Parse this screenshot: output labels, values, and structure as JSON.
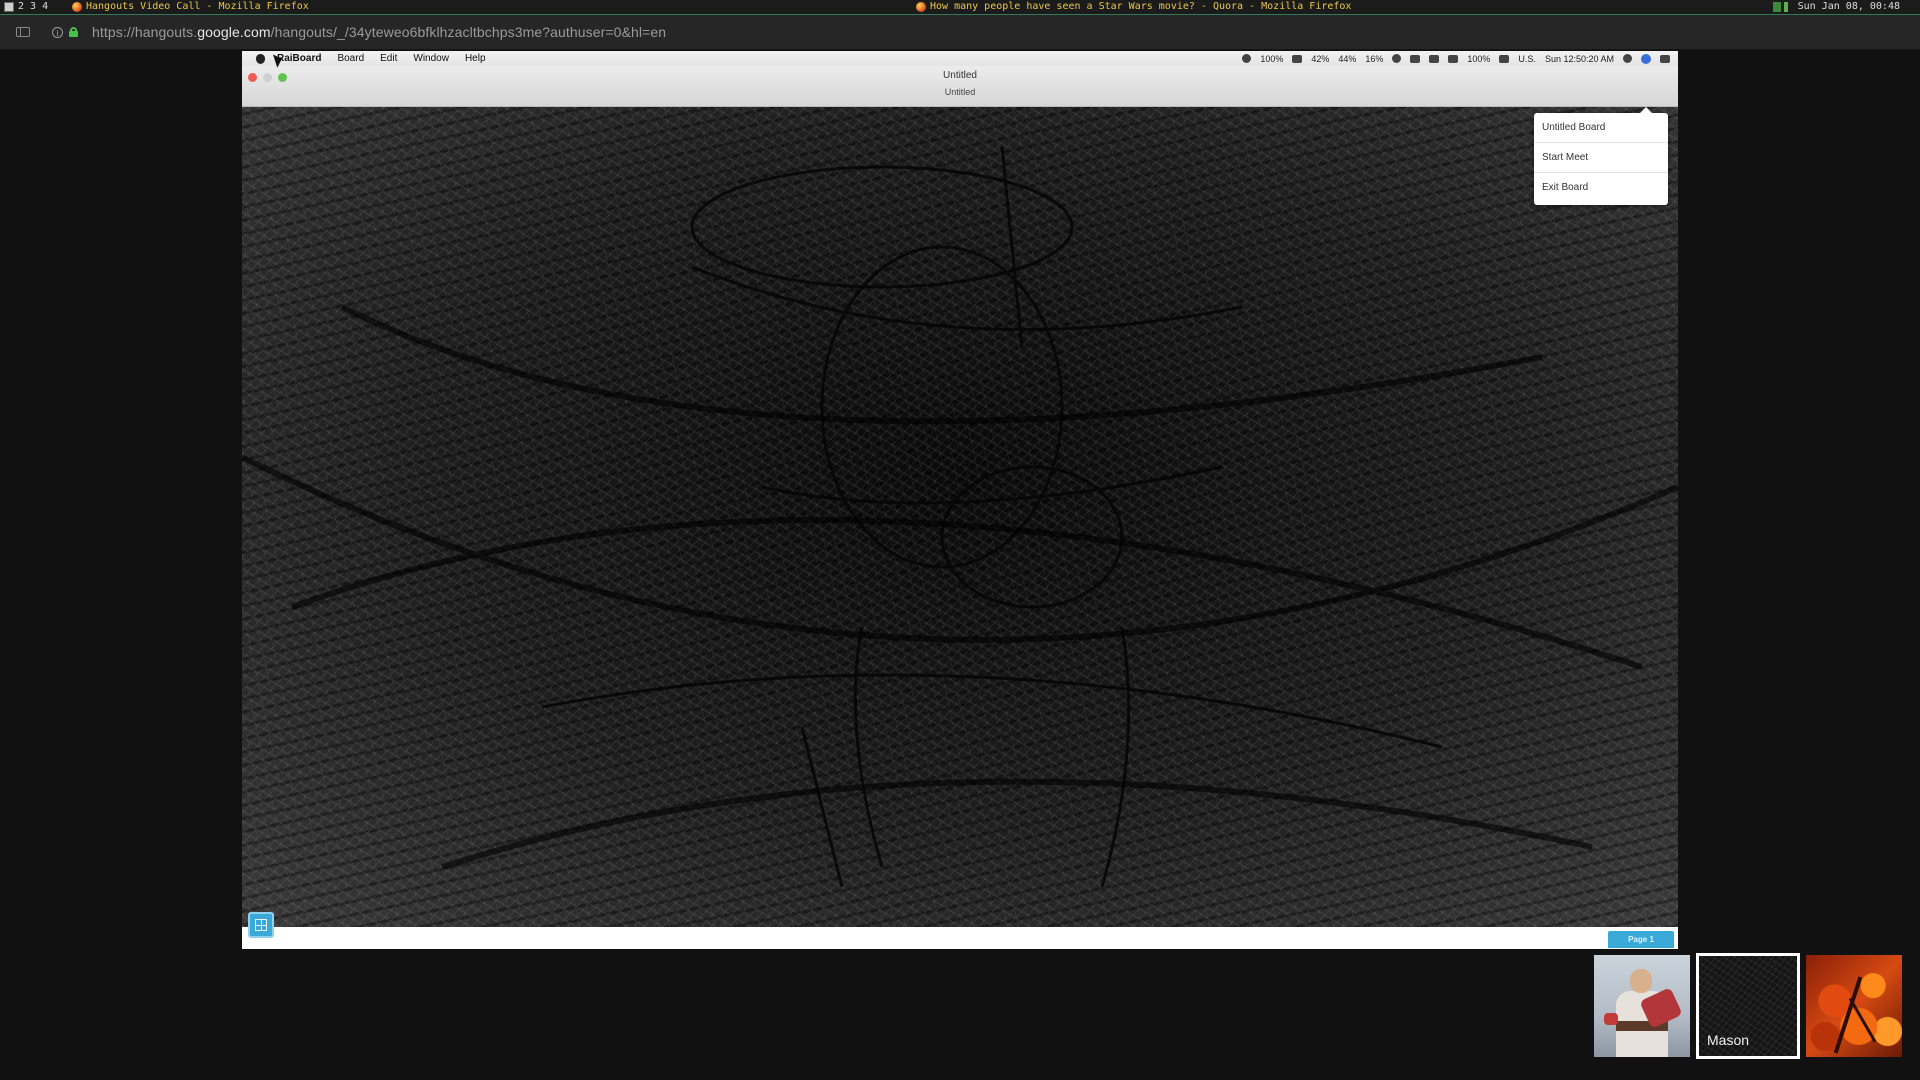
{
  "topbar": {
    "workspaces": [
      "2",
      "3",
      "4"
    ],
    "left_window_title": "Hangouts Video Call - Mozilla Firefox",
    "center_window_title": "How many people have seen a Star Wars movie? - Quora - Mozilla Firefox",
    "clock": "Sun Jan 08, 00:48"
  },
  "urlbar": {
    "url_prefix": "https://hangouts.",
    "url_host": "google.com",
    "url_rest": "/hangouts/_/34yteweo6bfklhzacltbchps3me?authuser=0&hl=en"
  },
  "mac": {
    "menu": {
      "app_name": "RaiBoard",
      "items": [
        "Board",
        "Edit",
        "Window",
        "Help"
      ]
    },
    "status": {
      "battery_a": "100%",
      "cpu": "42%",
      "mem": "44%",
      "disk": "16%",
      "battery_b": "100%",
      "locale": "U.S.",
      "clock": "Sun 12:50:20 AM"
    },
    "window": {
      "title": "Untitled",
      "subtitle": "Untitled"
    },
    "board_menu": {
      "items": [
        "Untitled Board",
        "Start Meet",
        "Exit Board"
      ]
    },
    "page_tab": "Page 1"
  },
  "participants": [
    {
      "name": "",
      "avatar": "medic-avatar"
    },
    {
      "name": "Mason",
      "avatar": "scribble-avatar"
    },
    {
      "name": "",
      "avatar": "autumn-tree-avatar"
    }
  ],
  "colors": {
    "accent_blue": "#3aa9d8",
    "topbar_text": "#e8c64a",
    "lock_green": "#46c24a"
  }
}
